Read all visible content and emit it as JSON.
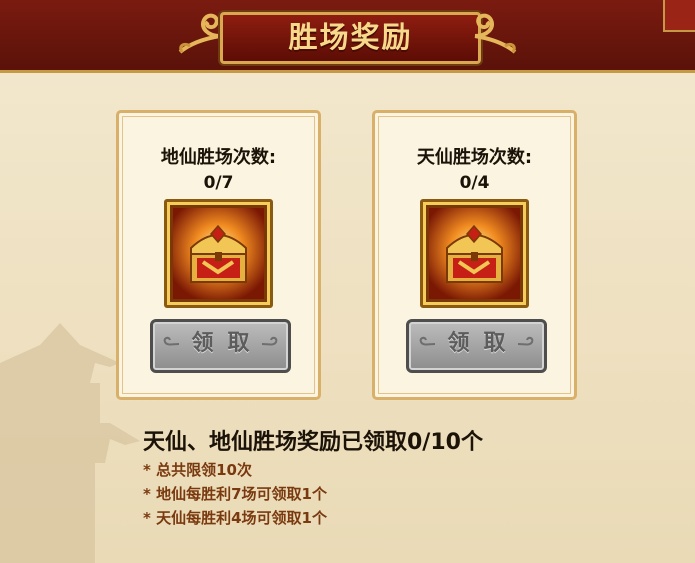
{
  "header": {
    "title": "胜场奖励"
  },
  "cards": [
    {
      "label": "地仙胜场次数:",
      "count": "0/7",
      "button": "领取",
      "icon": "treasure-chest-icon"
    },
    {
      "label": "天仙胜场次数:",
      "count": "0/4",
      "button": "领取",
      "icon": "treasure-chest-icon"
    }
  ],
  "summary": "天仙、地仙胜场奖励已领取0/10个",
  "notes": [
    "* 总共限领10次",
    "* 地仙每胜利7场可领取1个",
    "* 天仙每胜利4场可领取1个"
  ],
  "colors": {
    "header_bg": "#5a1209",
    "title_text": "#f7d98b",
    "note_text": "#7a3a10",
    "button_disabled": "#a5a5a5"
  }
}
